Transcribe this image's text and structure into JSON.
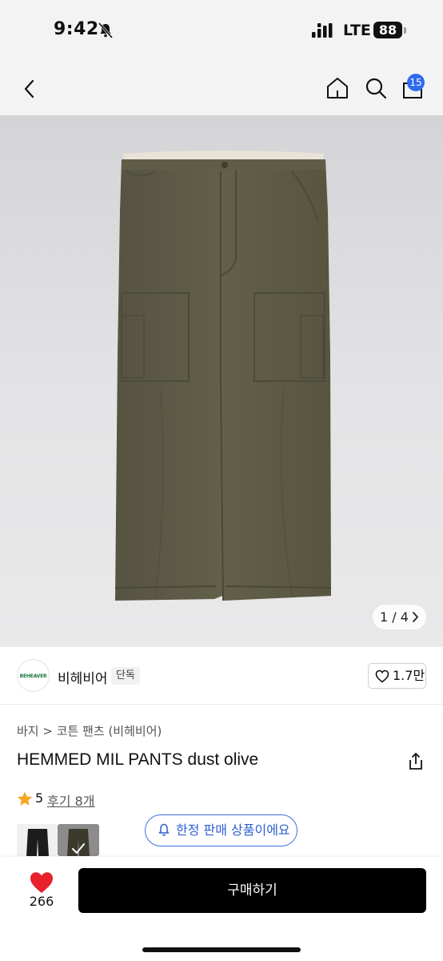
{
  "status_bar": {
    "time": "9:42",
    "network": "LTE",
    "battery": "88",
    "icons": [
      "bell-off-icon",
      "signal-icon",
      "battery-icon"
    ]
  },
  "nav": {
    "icons": [
      "chevron-left-icon",
      "home-icon",
      "search-icon",
      "shopping-bag-icon"
    ],
    "cart_count": "15"
  },
  "gallery": {
    "pager": "1 / 4"
  },
  "brand": {
    "logo_text": "BEHEAVER",
    "name": "비헤비어",
    "tag": "단독",
    "like_count": "1.7만"
  },
  "product": {
    "breadcrumb": "바지 > 코튼 팬츠 (비헤비어)",
    "title": "HEMMED MIL PANTS dust olive",
    "rating": "5",
    "reviews": "후기 8개",
    "limited_notice": "한정 판매 상품이에요"
  },
  "actions": {
    "heart_count": "266",
    "buy_label": "구매하기"
  },
  "colors": {
    "accent_blue": "#2f6bf0",
    "heart_red": "#e8212b",
    "star_orange": "#f5a623",
    "pants_olive": "#5c5a45"
  }
}
